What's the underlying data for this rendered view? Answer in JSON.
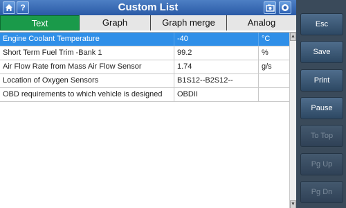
{
  "header": {
    "title": "Custom List",
    "help_glyph": "?"
  },
  "tabs": [
    {
      "label": "Text",
      "active": true
    },
    {
      "label": "Graph",
      "active": false
    },
    {
      "label": "Graph merge",
      "active": false
    },
    {
      "label": "Analog",
      "active": false
    }
  ],
  "table": {
    "rows": [
      {
        "name": "Engine Coolant Temperature",
        "value": "-40",
        "unit": "°C",
        "selected": true
      },
      {
        "name": "Short Term Fuel Trim -Bank 1",
        "value": "99.2",
        "unit": "%",
        "selected": false
      },
      {
        "name": "Air Flow Rate from Mass Air Flow Sensor",
        "value": "1.74",
        "unit": "g/s",
        "selected": false
      },
      {
        "name": "Location of Oxygen Sensors",
        "value": "B1S12--B2S12--",
        "unit": "",
        "selected": false
      },
      {
        "name": "OBD requirements to which vehicle is designed",
        "value": "OBDII",
        "unit": "",
        "selected": false
      }
    ]
  },
  "side_buttons": [
    {
      "label": "Esc",
      "enabled": true
    },
    {
      "label": "Save",
      "enabled": true
    },
    {
      "label": "Print",
      "enabled": true
    },
    {
      "label": "Pause",
      "enabled": true
    },
    {
      "label": "To Top",
      "enabled": false
    },
    {
      "label": "Pg Up",
      "enabled": false
    },
    {
      "label": "Pg Dn",
      "enabled": false
    }
  ],
  "colors": {
    "title_bar": "#2a5aa6",
    "active_tab": "#1a9a4a",
    "selected_row": "#2f8fe8",
    "side_panel": "#3a4a5a"
  },
  "icons": {
    "home": "home-icon",
    "help": "help-icon",
    "camera": "camera-icon",
    "record": "record-icon"
  }
}
